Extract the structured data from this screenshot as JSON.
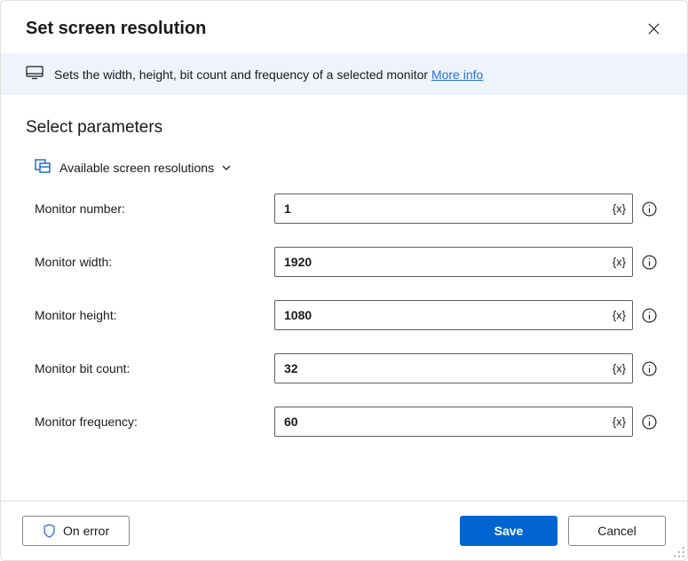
{
  "header": {
    "title": "Set screen resolution"
  },
  "info": {
    "text": "Sets the width, height, bit count and frequency of a selected monitor",
    "link_label": "More info"
  },
  "section": {
    "title": "Select parameters",
    "vars_label": "Available screen resolutions"
  },
  "fields": {
    "monitor_number": {
      "label": "Monitor number:",
      "value": "1"
    },
    "monitor_width": {
      "label": "Monitor width:",
      "value": "1920"
    },
    "monitor_height": {
      "label": "Monitor height:",
      "value": "1080"
    },
    "monitor_bit_count": {
      "label": "Monitor bit count:",
      "value": "32"
    },
    "monitor_frequency": {
      "label": "Monitor frequency:",
      "value": "60"
    }
  },
  "footer": {
    "on_error": "On error",
    "save": "Save",
    "cancel": "Cancel"
  },
  "tokens": {
    "fx": "{x}"
  }
}
